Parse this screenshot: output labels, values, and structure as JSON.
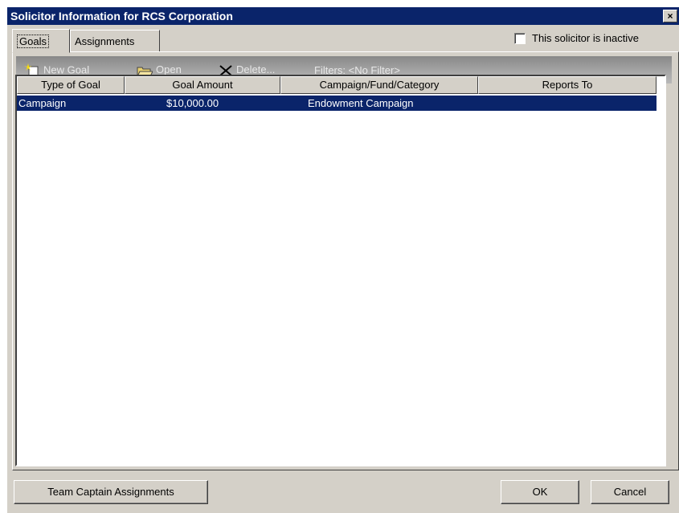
{
  "window": {
    "title": "Solicitor Information for RCS Corporation",
    "close_glyph": "×"
  },
  "tabs": [
    {
      "label": "Goals",
      "selected": true
    },
    {
      "label": "Assignments",
      "selected": false
    }
  ],
  "inactive_checkbox": {
    "label": "This solicitor is inactive",
    "checked": false
  },
  "toolbar": {
    "new_goal": "New Goal",
    "open": "Open",
    "delete": "Delete...",
    "filters": "Filters: <No Filter>",
    "icons": {
      "new_goal": "new-document-icon",
      "open": "open-folder-icon",
      "delete": "delete-x-icon"
    }
  },
  "table": {
    "columns": [
      "Type of Goal",
      "Goal Amount",
      "Campaign/Fund/Category",
      "Reports To"
    ],
    "rows": [
      {
        "type": "Campaign",
        "amount": "$10,000.00",
        "campaign": "Endowment Campaign",
        "reports_to": ""
      }
    ]
  },
  "buttons": {
    "team_captain": "Team Captain Assignments",
    "ok": "OK",
    "cancel": "Cancel"
  },
  "colors": {
    "titlebar": "#0a246a",
    "selection": "#0a246a",
    "face": "#d4d0c8"
  }
}
